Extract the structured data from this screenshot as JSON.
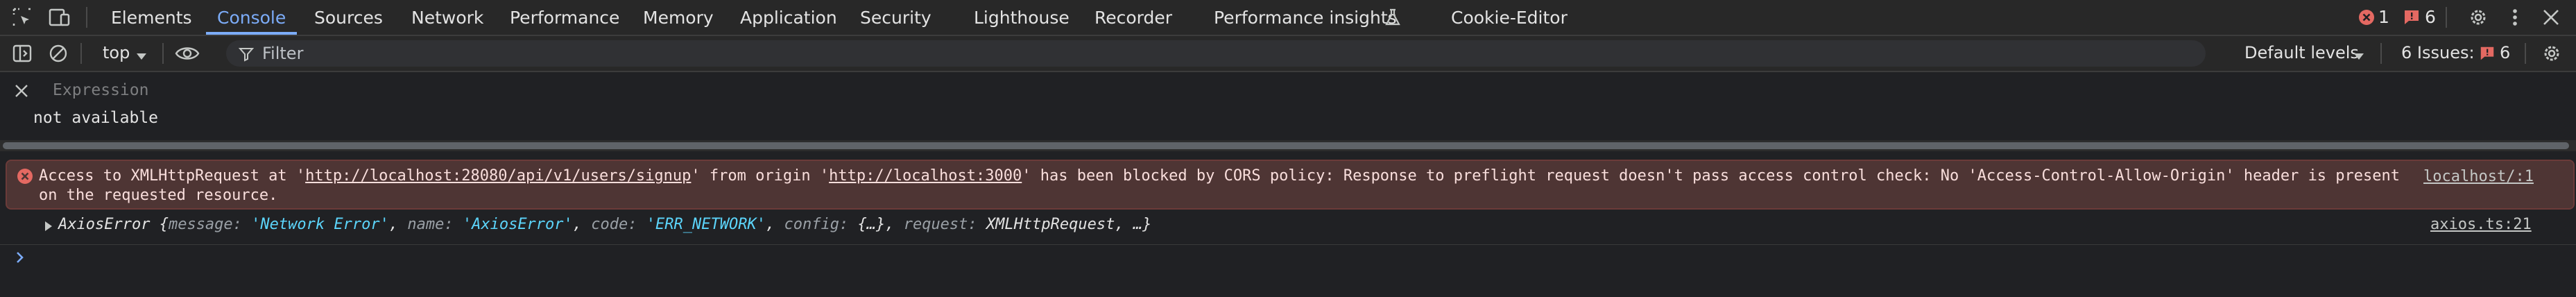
{
  "tabs": [
    {
      "label": "Elements",
      "active": false
    },
    {
      "label": "Console",
      "active": true
    },
    {
      "label": "Sources",
      "active": false
    },
    {
      "label": "Network",
      "active": false
    },
    {
      "label": "Performance",
      "active": false
    },
    {
      "label": "Memory",
      "active": false
    },
    {
      "label": "Application",
      "active": false
    },
    {
      "label": "Security",
      "active": false
    },
    {
      "label": "Lighthouse",
      "active": false
    },
    {
      "label": "Recorder",
      "active": false
    },
    {
      "label": "Performance insights",
      "active": false
    },
    {
      "label": "Cookie-Editor",
      "active": false
    }
  ],
  "status": {
    "errors": "1",
    "issues": "6"
  },
  "toolbar": {
    "context": "top",
    "filter_placeholder": "Filter",
    "levels": "Default levels",
    "issues_label": "6 Issues:",
    "issues_count": "6"
  },
  "live_expression": {
    "placeholder": "Expression",
    "value": "not available"
  },
  "error": {
    "prefix": "Access to XMLHttpRequest at '",
    "url1": "http://localhost:28080/api/v1/users/signup",
    "mid": "' from origin '",
    "url2": "http://localhost:3000",
    "suffix": "' has been blocked by CORS policy: Response to preflight request doesn't pass access control check: No 'Access-Control-Allow-Origin' header is present",
    "line2": "on the requested resource.",
    "source": "localhost/:1"
  },
  "axios": {
    "name": "AxiosError",
    "message_key": "message",
    "message_val": "'Network Error'",
    "name_key": "name",
    "name_val": "'AxiosError'",
    "code_key": "code",
    "code_val": "'ERR_NETWORK'",
    "config_key": "config",
    "config_val": "{…}",
    "request_key": "request",
    "request_val": "XMLHttpRequest, …",
    "source": "axios.ts:21"
  },
  "colors": {
    "accent": "#7cacf8",
    "error_bg": "#4e3534",
    "error_icon": "#e46962",
    "string": "#5cd5fb"
  },
  "icons": [
    "inspect-icon",
    "device-toggle-icon",
    "flask-icon",
    "error-icon",
    "issue-icon",
    "gear-icon",
    "more-vertical-icon",
    "close-icon",
    "sidebar-icon",
    "clear-icon",
    "dropdown-icon",
    "eye-icon",
    "filter-icon",
    "settings-icon",
    "chevron-right-icon"
  ]
}
